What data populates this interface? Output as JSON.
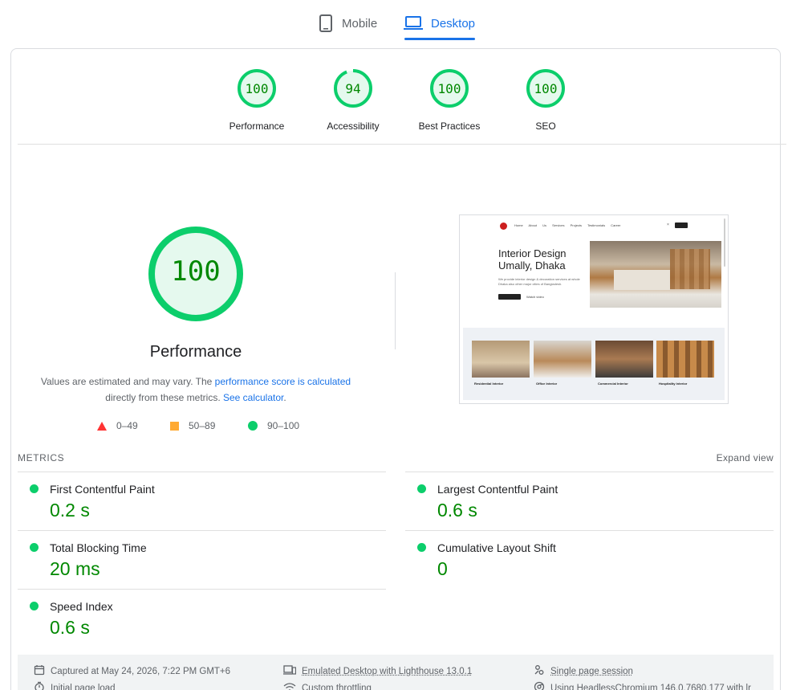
{
  "tabs": [
    {
      "label": "Mobile",
      "icon": "mobile-icon",
      "selected": false
    },
    {
      "label": "Desktop",
      "icon": "desktop-icon",
      "selected": true
    }
  ],
  "colors": {
    "pass": "#0cce6b",
    "pass_text": "#008800",
    "average": "#ffaa33",
    "fail": "#ff3333",
    "accent": "#1a73e8"
  },
  "categories": [
    {
      "label": "Performance",
      "score": "100",
      "value": 100
    },
    {
      "label": "Accessibility",
      "score": "94",
      "value": 94
    },
    {
      "label": "Best Practices",
      "score": "100",
      "value": 100
    },
    {
      "label": "SEO",
      "score": "100",
      "value": 100
    }
  ],
  "performance": {
    "score": "100",
    "value": 100,
    "title": "Performance",
    "desc_prefix": "Values are estimated and may vary. The ",
    "desc_link": "performance score is calculated",
    "desc_mid": " directly from these metrics. ",
    "desc_link2": "See calculator",
    "desc_suffix": "."
  },
  "legend": [
    {
      "label": "0–49",
      "shape": "triangle"
    },
    {
      "label": "50–89",
      "shape": "square"
    },
    {
      "label": "90–100",
      "shape": "circle"
    }
  ],
  "screenshot": {
    "nav_links": "Home About Us Services Projects Testimonials Career",
    "nav_close": "×",
    "heading_line1": "Interior Design",
    "heading_line2": "Umally, Dhaka",
    "paragraph": "We provide interior design & decoration services at whole Dhaka also other major cities of Bangladesh.",
    "cta2": "Watch video",
    "cards": [
      "Residential Interior",
      "Office Interior",
      "Commercial Interior",
      "Hospitality Interior"
    ]
  },
  "metrics": {
    "title": "METRICS",
    "expand_label": "Expand view",
    "items": [
      {
        "label": "First Contentful Paint",
        "value": "0.2 s"
      },
      {
        "label": "Largest Contentful Paint",
        "value": "0.6 s"
      },
      {
        "label": "Total Blocking Time",
        "value": "20 ms"
      },
      {
        "label": "Cumulative Layout Shift",
        "value": "0"
      },
      {
        "label": "Speed Index",
        "value": "0.6 s"
      }
    ]
  },
  "runtime": {
    "captured": "Captured at May 24, 2026, 7:22 PM GMT+6",
    "emulated": "Emulated Desktop with Lighthouse 13.0.1",
    "session": "Single page session",
    "load": "Initial page load",
    "throttling": "Custom throttling",
    "browser": "Using HeadlessChromium 146.0.7680.177 with lr"
  }
}
